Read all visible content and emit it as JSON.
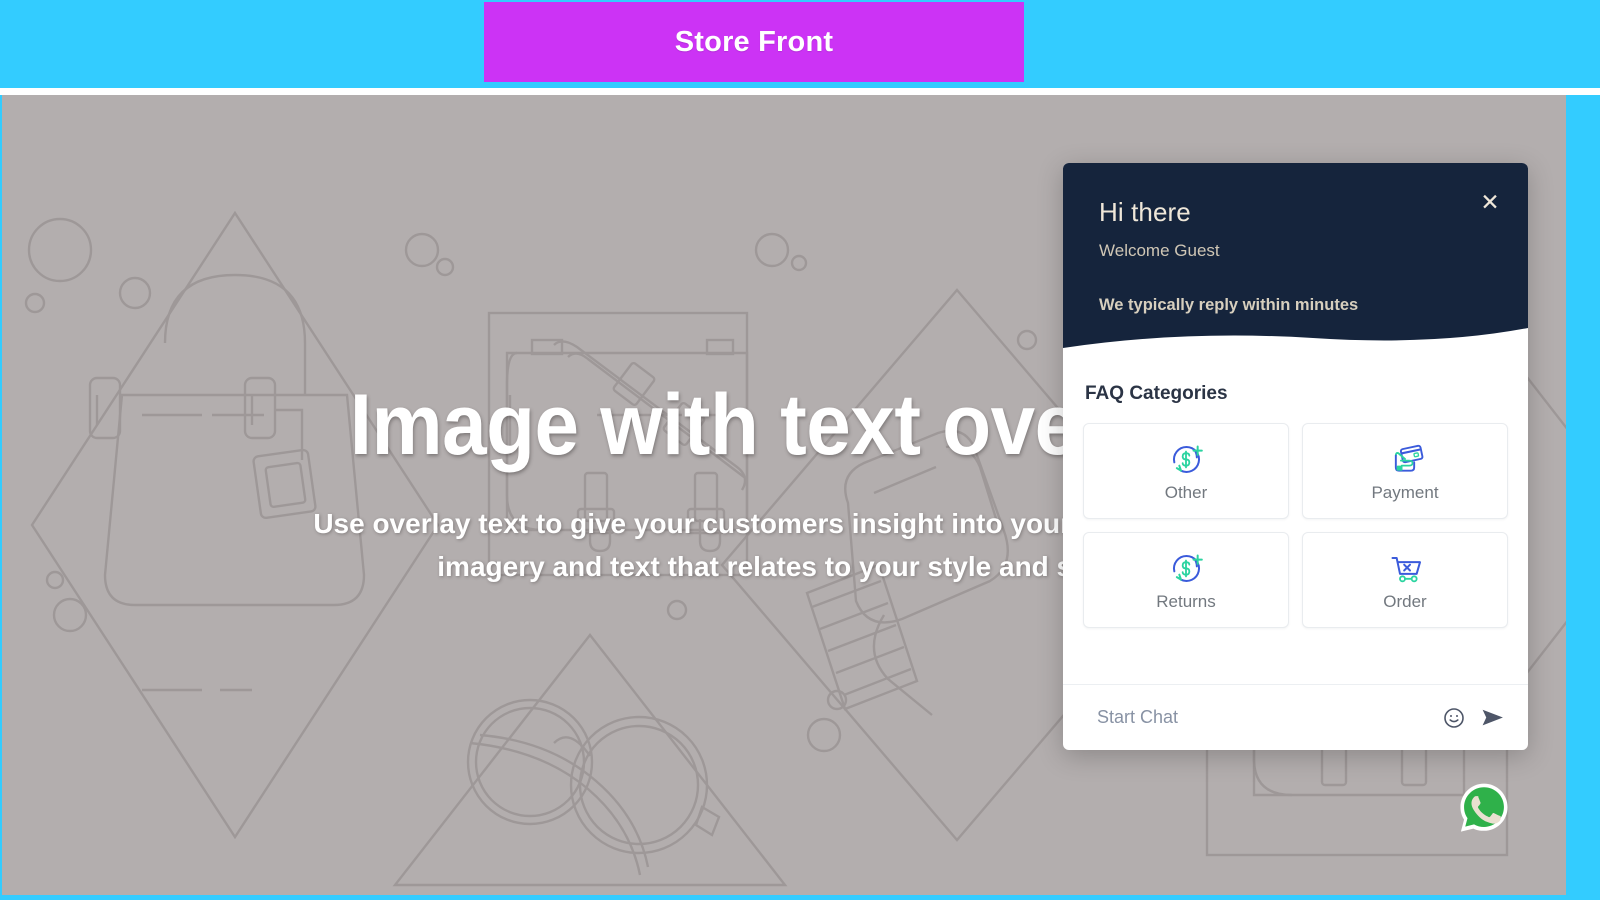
{
  "topbar": {
    "tab_label": "Store Front",
    "bar_color": "#33ccff",
    "tab_color": "#cc33f5"
  },
  "hero": {
    "heading": "Image with text overlay",
    "subtext": "Use overlay text to give your customers insight into your brand. Select imagery and text that relates to your style and story.",
    "background_color": "#b3aeae",
    "line_art_color": "#8d8787"
  },
  "chat_widget": {
    "header": {
      "title": "Hi there",
      "welcome": "Welcome Guest",
      "reply_time": "We typically reply within minutes",
      "close_label": "✕",
      "background_color": "#15243c",
      "text_color": "#efe7d9"
    },
    "faq": {
      "title": "FAQ Categories",
      "cards": [
        {
          "label": "Other",
          "icon": "refund-icon"
        },
        {
          "label": "Payment",
          "icon": "credit-card-hand-icon"
        },
        {
          "label": "Returns",
          "icon": "refund-icon"
        },
        {
          "label": "Order",
          "icon": "cart-cancel-icon"
        }
      ]
    },
    "footer": {
      "input_placeholder": "Start Chat",
      "input_value": "",
      "emoji_icon": "smiley-icon",
      "send_icon": "send-icon"
    }
  },
  "whatsapp_button": {
    "icon": "whatsapp-icon",
    "color": "#2fb14a"
  }
}
